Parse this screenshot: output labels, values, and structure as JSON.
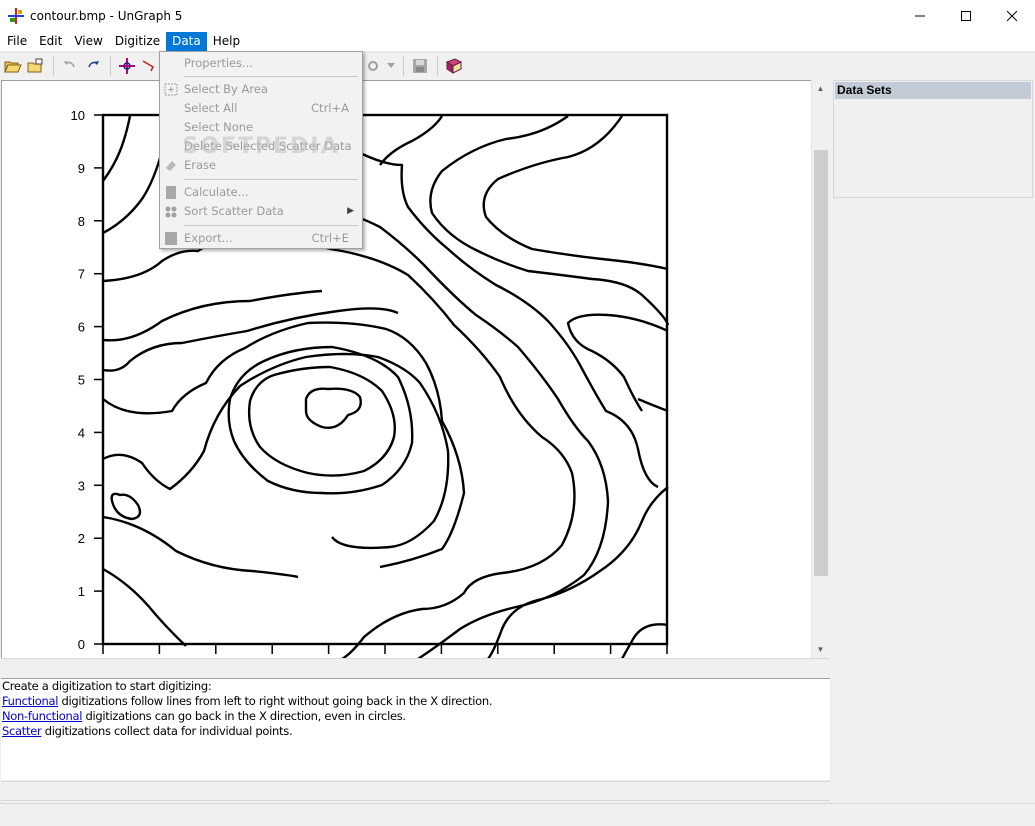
{
  "window": {
    "title": "contour.bmp - UnGraph 5",
    "minimize": "—",
    "maximize": "☐",
    "close": "✕"
  },
  "menu": {
    "file": "File",
    "edit": "Edit",
    "view": "View",
    "digitize": "Digitize",
    "data": "Data",
    "help": "Help"
  },
  "data_menu": {
    "properties": "Properties...",
    "select_by_area": "Select By Area",
    "select_all": "Select All",
    "select_all_shortcut": "Ctrl+A",
    "select_none": "Select None",
    "delete_selected": "Delete Selected Scatter Data",
    "erase": "Erase",
    "calculate": "Calculate...",
    "sort_scatter": "Sort Scatter Data",
    "export": "Export...",
    "export_shortcut": "Ctrl+E"
  },
  "watermark": "SOFTPEDIA",
  "datasets": {
    "header": "Data Sets"
  },
  "instructions": {
    "line1": "Create a digitization to start digitizing:",
    "functional_link": "Functional",
    "functional_text": " digitizations follow lines from left to right without going back in the X direction.",
    "nonfunctional_link": "Non-functional",
    "nonfunctional_text": " digitizations can go back in the X direction, even in circles.",
    "scatter_link": "Scatter",
    "scatter_text": " digitizations collect data for individual points."
  },
  "chart_data": {
    "type": "contour",
    "title": "",
    "xlabel": "",
    "ylabel": "",
    "ylim": [
      0,
      10
    ],
    "y_ticks": [
      "0",
      "1",
      "2",
      "3",
      "4",
      "5",
      "6",
      "7",
      "8",
      "9",
      "10"
    ],
    "x_tick_count": 11
  },
  "colors": {
    "menu_active": "#0078d7",
    "datasets_header": "#c3cbd6",
    "link": "#0000cc"
  }
}
